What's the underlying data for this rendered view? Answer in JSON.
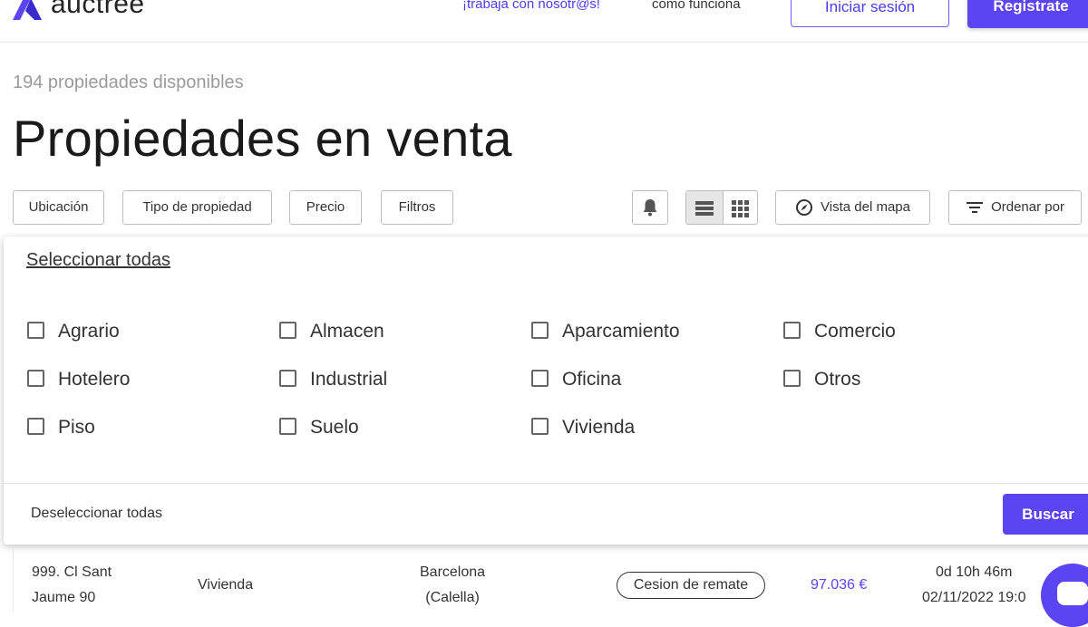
{
  "header": {
    "logo_text": "auctree",
    "nav_work": "¡trabaja con nosotr@s!",
    "nav_how": "como funciona",
    "login_label": "Iniciar sesión",
    "register_label": "Registrate"
  },
  "main": {
    "count_text": "194 propiedades disponibles",
    "title": "Propiedades en venta"
  },
  "filters": {
    "location": "Ubicación",
    "property_type": "Tipo de propiedad",
    "price": "Precio",
    "more": "Filtros",
    "map_view": "Vista del mapa",
    "sort": "Ordenar por"
  },
  "dropdown": {
    "select_all": "Seleccionar todas",
    "deselect_all": "Deseleccionar todas",
    "search_label": "Buscar",
    "options": [
      {
        "label": "Agrario",
        "checked": false
      },
      {
        "label": "Almacen",
        "checked": false
      },
      {
        "label": "Aparcamiento",
        "checked": false
      },
      {
        "label": "Comercio",
        "checked": false
      },
      {
        "label": "Hotelero",
        "checked": false
      },
      {
        "label": "Industrial",
        "checked": false
      },
      {
        "label": "Oficina",
        "checked": false
      },
      {
        "label": "Otros",
        "checked": false
      },
      {
        "label": "Piso",
        "checked": false
      },
      {
        "label": "Suelo",
        "checked": false
      },
      {
        "label": "Vivienda",
        "checked": false
      }
    ]
  },
  "result_row": {
    "address_line1": "999. Cl Sant",
    "address_line2": "Jaume 90",
    "type": "Vivienda",
    "location_line1": "Barcelona",
    "location_line2": "(Calella)",
    "badge": "Cesion de remate",
    "price": "97.036 €",
    "time_left": "0d 10h 46m",
    "end_date": "02/11/2022 19:0"
  },
  "colors": {
    "accent": "#5b44f2",
    "link": "#4a3cf0"
  }
}
